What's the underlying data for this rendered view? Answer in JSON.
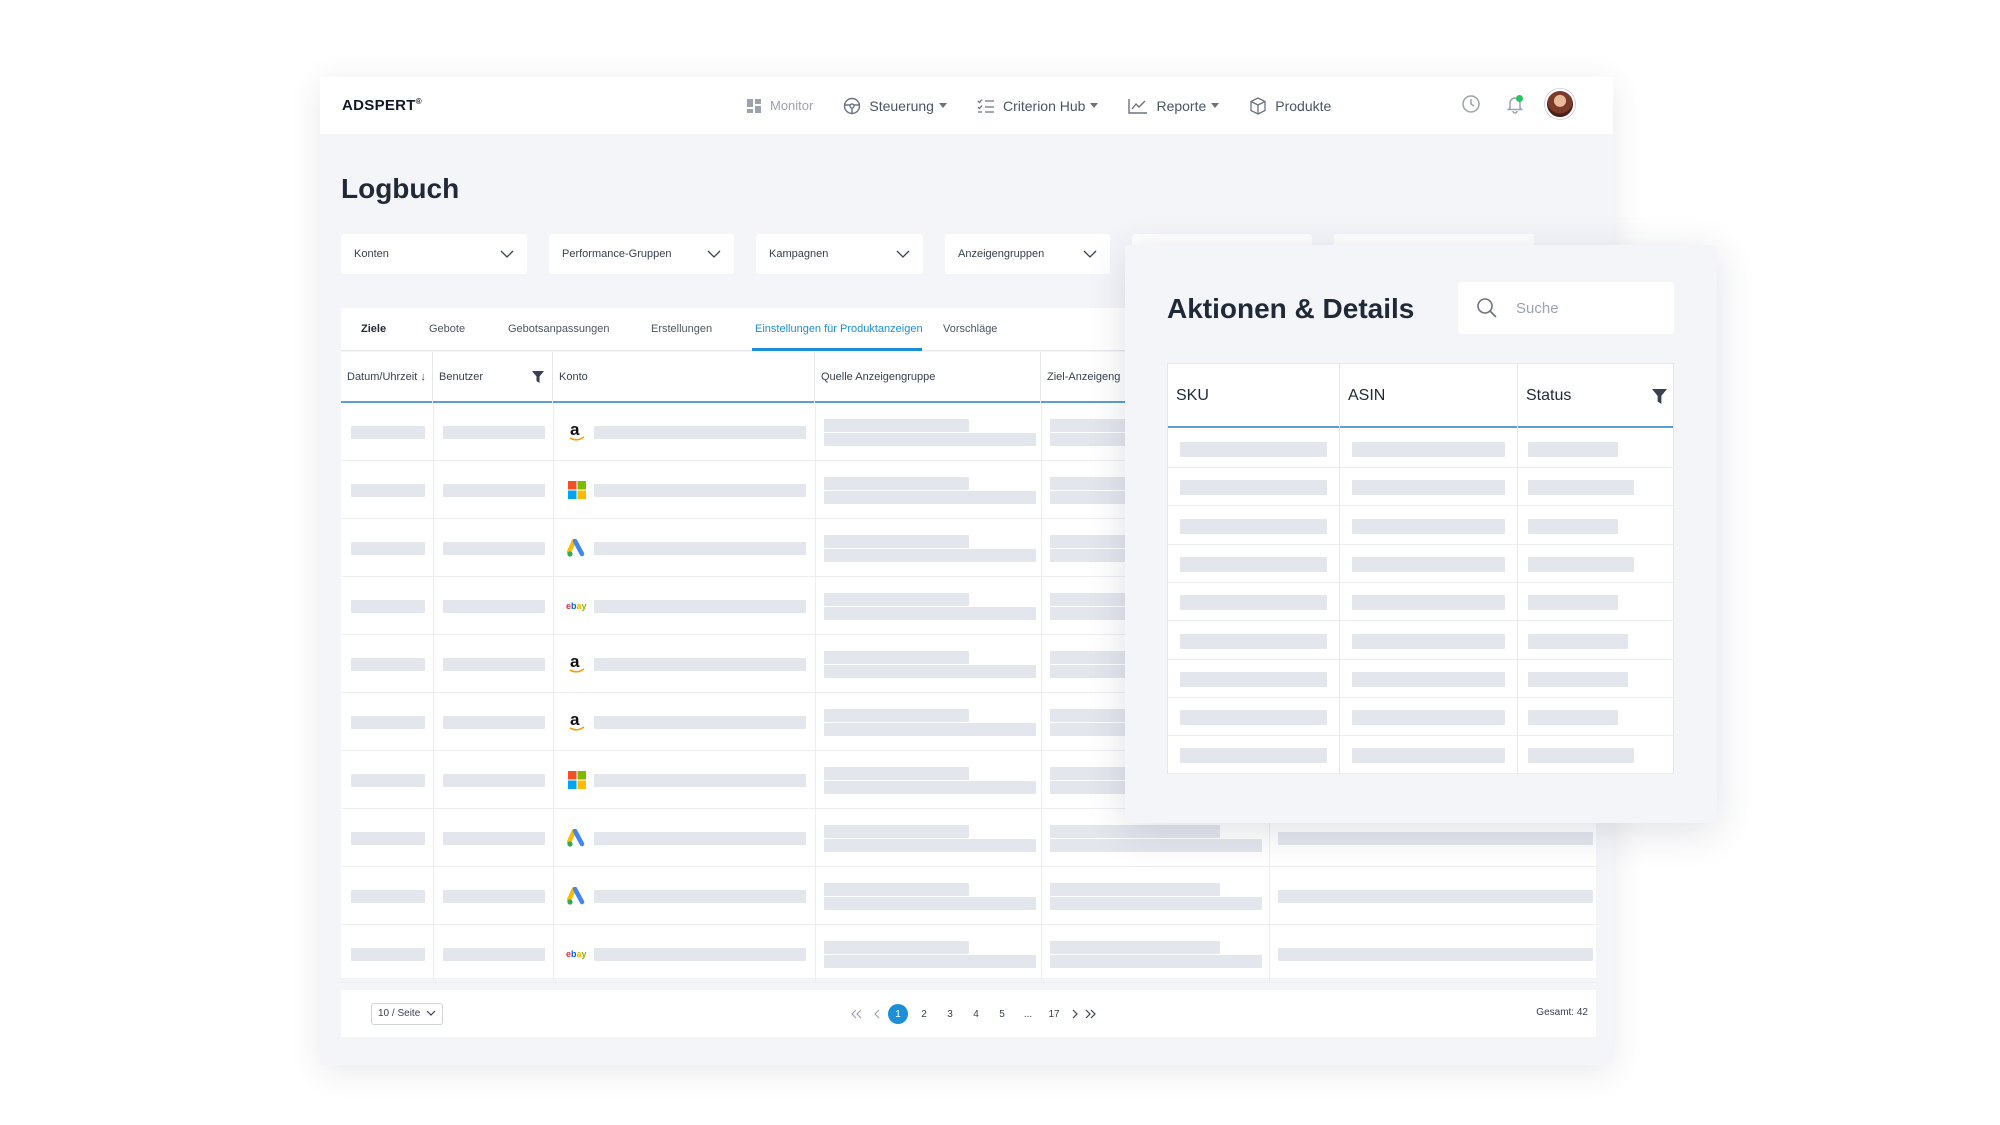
{
  "header": {
    "logo": "ADSPERT",
    "nav": [
      {
        "label": "Monitor",
        "icon": "dashboard-icon",
        "dropdown": false
      },
      {
        "label": "Steuerung",
        "icon": "steering-icon",
        "dropdown": true
      },
      {
        "label": "Criterion Hub",
        "icon": "checklist-icon",
        "dropdown": true
      },
      {
        "label": "Reporte",
        "icon": "chart-icon",
        "dropdown": true
      },
      {
        "label": "Produkte",
        "icon": "box-icon",
        "dropdown": false
      }
    ]
  },
  "page": {
    "title": "Logbuch",
    "filters": [
      "Konten",
      "Performance-Gruppen",
      "Kampagnen",
      "Anzeigengruppen"
    ],
    "tabs": [
      "Ziele",
      "Gebote",
      "Gebotsanpassungen",
      "Erstellungen",
      "Einstellungen für Produktanzeigen",
      "Vorschläge"
    ],
    "active_tab": "Einstellungen für Produktanzeigen"
  },
  "table": {
    "columns": [
      "Datum/Uhrzeit",
      "Benutzer",
      "Konto",
      "Quelle Anzeigengruppe",
      "Ziel-Anzeigeng"
    ],
    "rows_account_icons": [
      "amazon-icon",
      "microsoft-icon",
      "google-ads-icon",
      "ebay-icon",
      "amazon-icon",
      "amazon-icon",
      "microsoft-icon",
      "google-ads-icon",
      "google-ads-icon",
      "ebay-icon"
    ]
  },
  "pagination": {
    "per_page": "10 / Seite",
    "pages": [
      "1",
      "2",
      "3",
      "4",
      "5",
      "...",
      "17"
    ],
    "current": "1",
    "total": "Gesamt: 42"
  },
  "panel": {
    "title": "Aktionen & Details",
    "search_placeholder": "Suche",
    "columns": [
      "SKU",
      "ASIN",
      "Status"
    ],
    "row_count": 9
  },
  "colors": {
    "accent": "#1d8fd6",
    "background": "#f4f5f9",
    "skeleton": "#e4e6ee"
  }
}
